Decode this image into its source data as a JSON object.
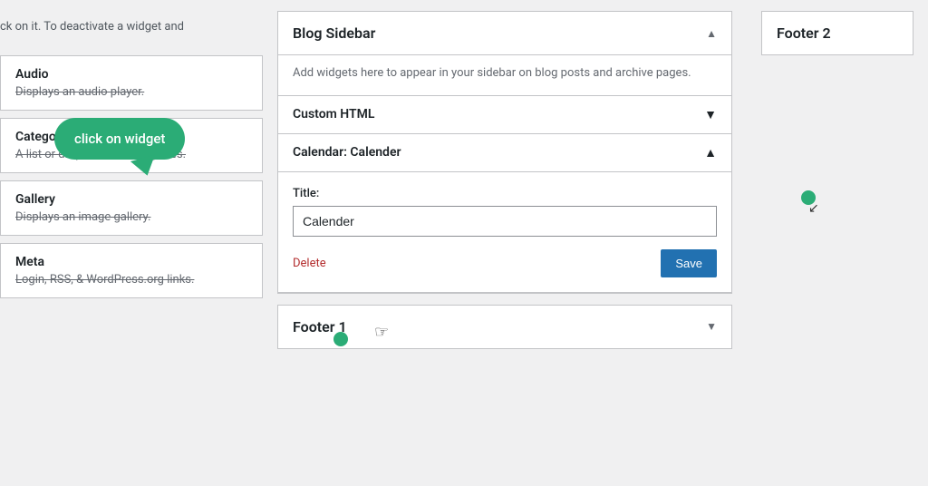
{
  "left_panel": {
    "intro_text": "ck on it. To deactivate a widget and",
    "tooltip_text": "click on widget",
    "widgets": [
      {
        "name": "Audio",
        "desc": "Displays an audio player."
      },
      {
        "name": "Categories",
        "desc": "A list or dropdown of categories."
      },
      {
        "name": "Gallery",
        "desc": "Displays an image gallery."
      },
      {
        "name": "Meta",
        "desc": "Login, RSS, & WordPress.org links."
      }
    ]
  },
  "blog_sidebar": {
    "title": "Blog Sidebar",
    "description": "Add widgets here to appear in your sidebar on blog posts and archive pages.",
    "arrow_up": "▲",
    "arrow_down": "▼",
    "custom_html_label": "Custom HTML",
    "calendar_widget": {
      "label": "Calendar: Calender",
      "title_field_label": "Title:",
      "title_field_value": "Calender",
      "delete_label": "Delete",
      "save_label": "Save"
    }
  },
  "footer1": {
    "title": "Footer 1",
    "arrow": "▼"
  },
  "footer2": {
    "title": "Footer 2"
  }
}
